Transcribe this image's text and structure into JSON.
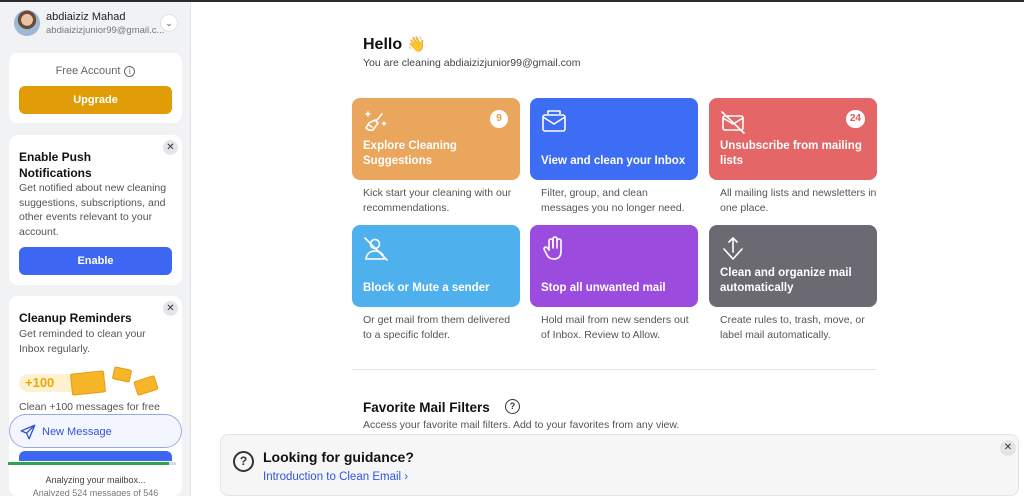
{
  "account": {
    "name": "abdiaiziz Mahad",
    "email": "abdiaizizjunior99@gmail.c...",
    "chevron": "⌄"
  },
  "free_card": {
    "label": "Free Account",
    "info_icon": "i",
    "upgrade_label": "Upgrade"
  },
  "push_card": {
    "title": "Enable Push Notifications",
    "description": "Get notified about new cleaning suggestions, subscriptions, and other events relevant to your account.",
    "button_label": "Enable",
    "close": "✕"
  },
  "reminder_card": {
    "title": "Cleanup Reminders",
    "description": "Get reminded to clean your Inbox regularly.",
    "art_text": "+100",
    "line": "Clean +100 messages for free",
    "close": "✕"
  },
  "new_message": {
    "label": "New Message"
  },
  "analysis": {
    "title": "Analyzing your mailbox...",
    "subtitle": "Analyzed 524 messages of 546",
    "progress_fraction": 0.96
  },
  "main": {
    "greeting": "Hello",
    "wave": "👋",
    "subtitle": "You are cleaning abdiaizizjunior99@gmail.com"
  },
  "tiles": [
    {
      "title": "Explore Cleaning Suggestions",
      "badge": "9",
      "desc": "Kick start your cleaning with our recommendations.",
      "color": "#eaa65c",
      "badge_color": "#e39a4a",
      "icon": "broom-sparkle-icon"
    },
    {
      "title": "View and clean your Inbox",
      "badge": "",
      "desc": "Filter, group, and clean messages you no longer need.",
      "color": "#3d6df4",
      "icon": "mail-open-icon"
    },
    {
      "title": "Unsubscribe from mailing lists",
      "badge": "24",
      "desc": "All mailing lists and newsletters in one place.",
      "color": "#e46666",
      "badge_color": "#e05a5a",
      "icon": "mail-off-icon"
    },
    {
      "title": "Block or Mute a sender",
      "badge": "",
      "desc": "Or get mail from them delivered to a specific folder.",
      "color": "#4fb0ee",
      "icon": "user-block-icon"
    },
    {
      "title": "Stop all unwanted mail",
      "badge": "",
      "desc": "Hold mail from new senders out of Inbox. Review to Allow.",
      "color": "#9b4cdf",
      "icon": "hand-stop-icon"
    },
    {
      "title": "Clean and organize mail automatically",
      "badge": "",
      "desc": "Create rules to, trash, move, or label mail automatically.",
      "color": "#6b6a72",
      "icon": "arrows-move-icon"
    }
  ],
  "favorites": {
    "title": "Favorite Mail Filters",
    "help_icon": "?",
    "subtitle": "Access your favorite mail filters. Add to your favorites from any view."
  },
  "guidance": {
    "icon": "?",
    "title": "Looking for guidance?",
    "link": "Introduction to Clean Email ›",
    "close": "✕"
  }
}
